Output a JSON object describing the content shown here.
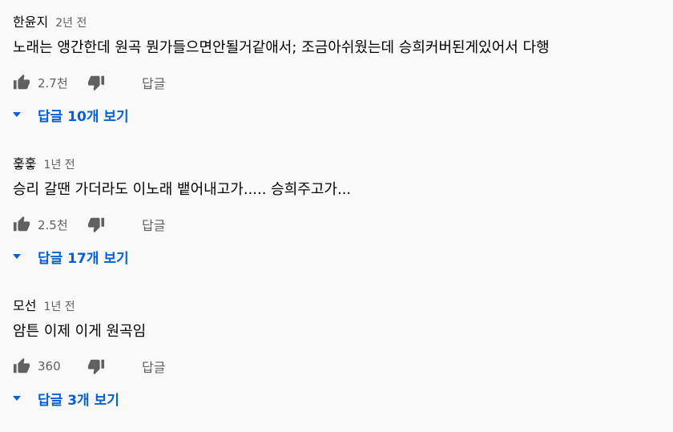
{
  "comments": [
    {
      "author": "한윤지",
      "time": "2년 전",
      "text": "노래는 앵간한데 원곡 뭔가들으면안될거같애서; 조금아쉬웠는데 승희커버된게있어서 다행",
      "likes": "2.7천",
      "reply_label": "답글",
      "replies_label": "답글 10개 보기",
      "like_icon": "thumbs-up-icon",
      "dislike_icon": "thumbs-down-icon"
    },
    {
      "author": "훟훟",
      "time": "1년 전",
      "text": "승리 갈땐 가더라도 이노래 뱉어내고가..... 승희주고가...",
      "likes": "2.5천",
      "reply_label": "답글",
      "replies_label": "답글 17개 보기",
      "like_icon": "thumbs-up-icon",
      "dislike_icon": "thumbs-down-icon"
    },
    {
      "author": "모선",
      "time": "1년 전",
      "text": "암튼 이제 이게 원곡임",
      "likes": "360",
      "reply_label": "답글",
      "replies_label": "답글 3개 보기",
      "like_icon": "thumbs-up-icon",
      "dislike_icon": "thumbs-down-icon"
    }
  ],
  "colors": {
    "background": "#f9f9f9",
    "text_primary": "#030303",
    "text_secondary": "#606060",
    "link_blue": "#065fd4"
  }
}
